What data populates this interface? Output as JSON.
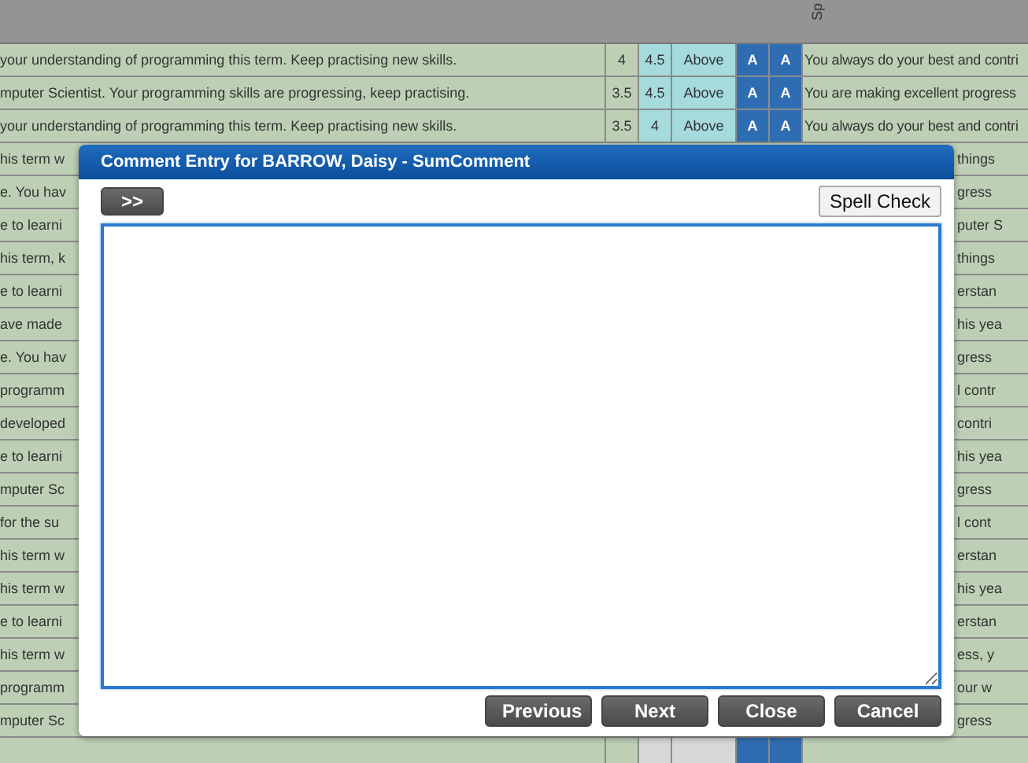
{
  "header": {
    "column_label": "Sp"
  },
  "rows": [
    {
      "comment": "your understanding of programming this term. Keep practising new skills.",
      "score_1": "4",
      "score_2": "4.5",
      "level": "Above",
      "grade_1": "A",
      "grade_2": "A",
      "comment_2": "You always do your best and contri"
    },
    {
      "comment": "mputer Scientist. Your programming skills are progressing, keep practising.",
      "score_1": "3.5",
      "score_2": "4.5",
      "level": "Above",
      "grade_1": "A",
      "grade_2": "A",
      "comment_2": "You are making excellent progress"
    },
    {
      "comment": "your understanding of programming this term. Keep practising new skills.",
      "score_1": "3.5",
      "score_2": "4",
      "level": "Above",
      "grade_1": "A",
      "grade_2": "A",
      "comment_2": "You always do your best and contri"
    }
  ],
  "partial_rows": [
    {
      "left": "his term w",
      "right": "things"
    },
    {
      "left": "e. You hav",
      "right": "gress"
    },
    {
      "left": "e to learni",
      "right": "puter S"
    },
    {
      "left": "his term, k",
      "right": "things"
    },
    {
      "left": "e to learni",
      "right": "erstan"
    },
    {
      "left": "ave made",
      "right": "his yea"
    },
    {
      "left": "e. You hav",
      "right": "gress"
    },
    {
      "left": "programm",
      "right": "l contr"
    },
    {
      "left": "developed",
      "right": "contri"
    },
    {
      "left": "e to learni",
      "right": "his yea"
    },
    {
      "left": "mputer Sc",
      "right": "gress"
    },
    {
      "left": "for the su",
      "right": "l cont"
    },
    {
      "left": "his term w",
      "right": "erstan"
    },
    {
      "left": "his term w",
      "right": "his yea"
    },
    {
      "left": "e to learni",
      "right": "erstan"
    },
    {
      "left": "his term w",
      "right": "ess, y"
    },
    {
      "left": "programm",
      "right": "our w"
    },
    {
      "left": "mputer Sc",
      "right": "gress"
    }
  ],
  "dialog": {
    "title": "Comment Entry for BARROW, Daisy - SumComment",
    "expand_button": ">>",
    "spell_check_button": "Spell Check",
    "buttons": [
      "Previous",
      "Next",
      "Close",
      "Cancel"
    ]
  }
}
